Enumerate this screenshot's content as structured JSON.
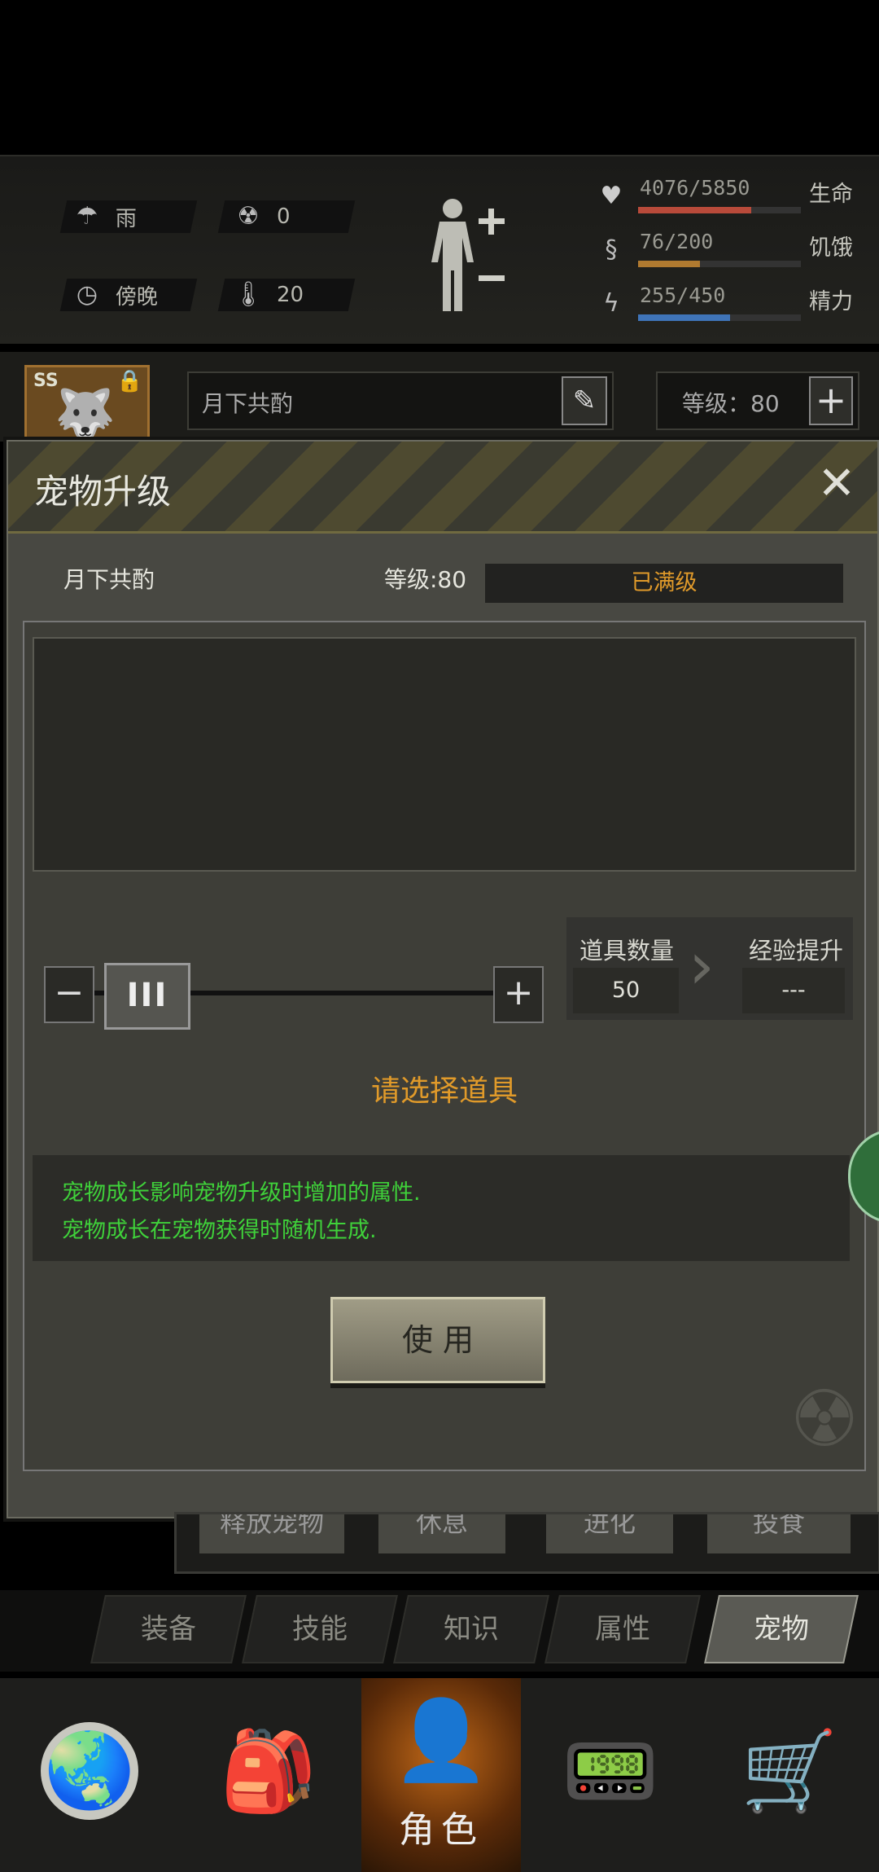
{
  "status": {
    "weather": {
      "icon": "rain-cloud-icon",
      "label": "雨"
    },
    "radiation": {
      "icon": "radiation-icon",
      "value": "0"
    },
    "time": {
      "icon": "clock-icon",
      "label": "傍晚"
    },
    "temperature": {
      "icon": "thermometer-icon",
      "value": "20"
    },
    "bars": [
      {
        "name": "生命",
        "value": "4076/5850",
        "ratio": 0.697,
        "color": "#b84a3a",
        "icon": "heart-icon"
      },
      {
        "name": "饥饿",
        "value": "76/200",
        "ratio": 0.38,
        "color": "#b07a30",
        "icon": "stomach-icon"
      },
      {
        "name": "精力",
        "value": "255/450",
        "ratio": 0.567,
        "color": "#3f74b8",
        "icon": "energy-icon"
      }
    ]
  },
  "pet_strip": {
    "badge": "SS",
    "name": "月下共酌",
    "level_label": "等级：80"
  },
  "modal": {
    "title": "宠物升级",
    "pet_name": "月下共酌",
    "level_text": "等级:80",
    "max_level_text": "已满级",
    "item_count_label": "道具数量",
    "item_count_value": "50",
    "exp_label": "经验提升",
    "exp_value": "---",
    "prompt": "请选择道具",
    "info_lines": [
      "宠物成长影响宠物升级时增加的属性.",
      "宠物成长在宠物获得时随机生成."
    ],
    "use_button": "使 用",
    "slider_fraction": 0.0
  },
  "behind_buttons": [
    "释放宠物",
    "休息",
    "进化",
    "投食"
  ],
  "tabs": [
    "装备",
    "技能",
    "知识",
    "属性",
    "宠物"
  ],
  "active_tab": 4,
  "nav": {
    "active_label": "角色",
    "items": [
      "globe-icon",
      "backpack-icon",
      "character-icon",
      "radio-icon",
      "cart-icon"
    ]
  },
  "colors": {
    "accent_orange": "#e09a2a",
    "info_green": "#3fd13a"
  }
}
